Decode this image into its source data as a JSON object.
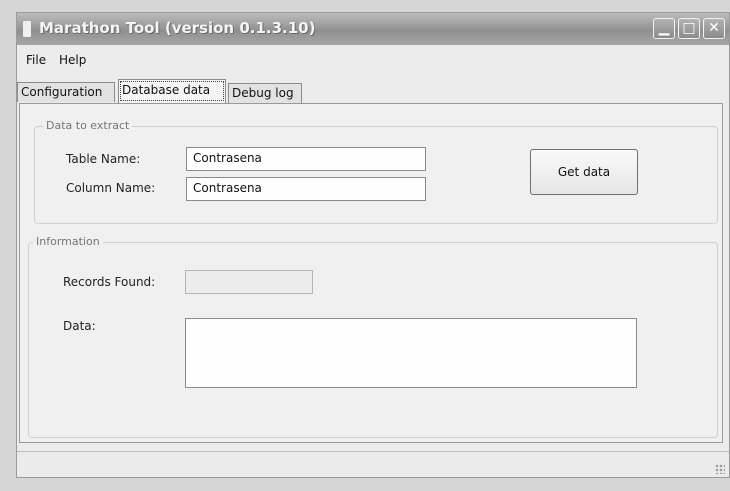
{
  "window": {
    "title": "Marathon Tool  (version 0.1.3.10)",
    "icon": "app-icon"
  },
  "menu": {
    "file": "File",
    "help": "Help"
  },
  "tabs": [
    {
      "label": "Configuration",
      "selected": false
    },
    {
      "label": "Database data",
      "selected": true
    },
    {
      "label": "Debug log",
      "selected": false
    }
  ],
  "extract": {
    "legend": "Data to extract",
    "table_label": "Table Name:",
    "table_value": "Contrasena",
    "column_label": "Column Name:",
    "column_value": "Contrasena",
    "get_data_button": "Get data"
  },
  "information": {
    "legend": "Information",
    "records_label": "Records Found:",
    "records_value": "",
    "data_label": "Data:",
    "data_value": ""
  },
  "colors": {
    "titlebar": "#9a9a9a",
    "window_bg": "#ececec"
  }
}
